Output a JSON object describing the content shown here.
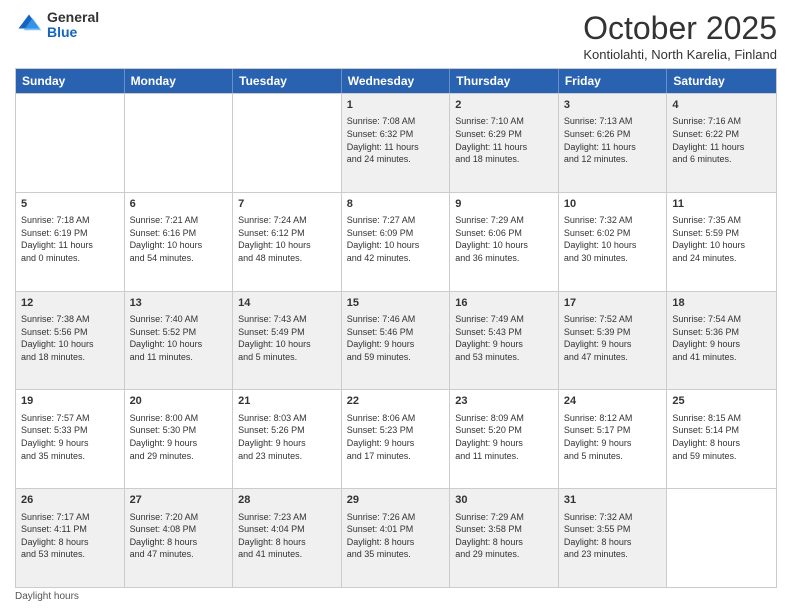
{
  "header": {
    "logo_general": "General",
    "logo_blue": "Blue",
    "month": "October 2025",
    "location": "Kontiolahti, North Karelia, Finland"
  },
  "days_of_week": [
    "Sunday",
    "Monday",
    "Tuesday",
    "Wednesday",
    "Thursday",
    "Friday",
    "Saturday"
  ],
  "footer": {
    "note": "Daylight hours"
  },
  "weeks": [
    {
      "cells": [
        {
          "day": "",
          "content": ""
        },
        {
          "day": "",
          "content": ""
        },
        {
          "day": "",
          "content": ""
        },
        {
          "day": "1",
          "content": "Sunrise: 7:08 AM\nSunset: 6:32 PM\nDaylight: 11 hours\nand 24 minutes."
        },
        {
          "day": "2",
          "content": "Sunrise: 7:10 AM\nSunset: 6:29 PM\nDaylight: 11 hours\nand 18 minutes."
        },
        {
          "day": "3",
          "content": "Sunrise: 7:13 AM\nSunset: 6:26 PM\nDaylight: 11 hours\nand 12 minutes."
        },
        {
          "day": "4",
          "content": "Sunrise: 7:16 AM\nSunset: 6:22 PM\nDaylight: 11 hours\nand 6 minutes."
        }
      ]
    },
    {
      "cells": [
        {
          "day": "5",
          "content": "Sunrise: 7:18 AM\nSunset: 6:19 PM\nDaylight: 11 hours\nand 0 minutes."
        },
        {
          "day": "6",
          "content": "Sunrise: 7:21 AM\nSunset: 6:16 PM\nDaylight: 10 hours\nand 54 minutes."
        },
        {
          "day": "7",
          "content": "Sunrise: 7:24 AM\nSunset: 6:12 PM\nDaylight: 10 hours\nand 48 minutes."
        },
        {
          "day": "8",
          "content": "Sunrise: 7:27 AM\nSunset: 6:09 PM\nDaylight: 10 hours\nand 42 minutes."
        },
        {
          "day": "9",
          "content": "Sunrise: 7:29 AM\nSunset: 6:06 PM\nDaylight: 10 hours\nand 36 minutes."
        },
        {
          "day": "10",
          "content": "Sunrise: 7:32 AM\nSunset: 6:02 PM\nDaylight: 10 hours\nand 30 minutes."
        },
        {
          "day": "11",
          "content": "Sunrise: 7:35 AM\nSunset: 5:59 PM\nDaylight: 10 hours\nand 24 minutes."
        }
      ]
    },
    {
      "cells": [
        {
          "day": "12",
          "content": "Sunrise: 7:38 AM\nSunset: 5:56 PM\nDaylight: 10 hours\nand 18 minutes."
        },
        {
          "day": "13",
          "content": "Sunrise: 7:40 AM\nSunset: 5:52 PM\nDaylight: 10 hours\nand 11 minutes."
        },
        {
          "day": "14",
          "content": "Sunrise: 7:43 AM\nSunset: 5:49 PM\nDaylight: 10 hours\nand 5 minutes."
        },
        {
          "day": "15",
          "content": "Sunrise: 7:46 AM\nSunset: 5:46 PM\nDaylight: 9 hours\nand 59 minutes."
        },
        {
          "day": "16",
          "content": "Sunrise: 7:49 AM\nSunset: 5:43 PM\nDaylight: 9 hours\nand 53 minutes."
        },
        {
          "day": "17",
          "content": "Sunrise: 7:52 AM\nSunset: 5:39 PM\nDaylight: 9 hours\nand 47 minutes."
        },
        {
          "day": "18",
          "content": "Sunrise: 7:54 AM\nSunset: 5:36 PM\nDaylight: 9 hours\nand 41 minutes."
        }
      ]
    },
    {
      "cells": [
        {
          "day": "19",
          "content": "Sunrise: 7:57 AM\nSunset: 5:33 PM\nDaylight: 9 hours\nand 35 minutes."
        },
        {
          "day": "20",
          "content": "Sunrise: 8:00 AM\nSunset: 5:30 PM\nDaylight: 9 hours\nand 29 minutes."
        },
        {
          "day": "21",
          "content": "Sunrise: 8:03 AM\nSunset: 5:26 PM\nDaylight: 9 hours\nand 23 minutes."
        },
        {
          "day": "22",
          "content": "Sunrise: 8:06 AM\nSunset: 5:23 PM\nDaylight: 9 hours\nand 17 minutes."
        },
        {
          "day": "23",
          "content": "Sunrise: 8:09 AM\nSunset: 5:20 PM\nDaylight: 9 hours\nand 11 minutes."
        },
        {
          "day": "24",
          "content": "Sunrise: 8:12 AM\nSunset: 5:17 PM\nDaylight: 9 hours\nand 5 minutes."
        },
        {
          "day": "25",
          "content": "Sunrise: 8:15 AM\nSunset: 5:14 PM\nDaylight: 8 hours\nand 59 minutes."
        }
      ]
    },
    {
      "cells": [
        {
          "day": "26",
          "content": "Sunrise: 7:17 AM\nSunset: 4:11 PM\nDaylight: 8 hours\nand 53 minutes."
        },
        {
          "day": "27",
          "content": "Sunrise: 7:20 AM\nSunset: 4:08 PM\nDaylight: 8 hours\nand 47 minutes."
        },
        {
          "day": "28",
          "content": "Sunrise: 7:23 AM\nSunset: 4:04 PM\nDaylight: 8 hours\nand 41 minutes."
        },
        {
          "day": "29",
          "content": "Sunrise: 7:26 AM\nSunset: 4:01 PM\nDaylight: 8 hours\nand 35 minutes."
        },
        {
          "day": "30",
          "content": "Sunrise: 7:29 AM\nSunset: 3:58 PM\nDaylight: 8 hours\nand 29 minutes."
        },
        {
          "day": "31",
          "content": "Sunrise: 7:32 AM\nSunset: 3:55 PM\nDaylight: 8 hours\nand 23 minutes."
        },
        {
          "day": "",
          "content": ""
        }
      ]
    }
  ]
}
